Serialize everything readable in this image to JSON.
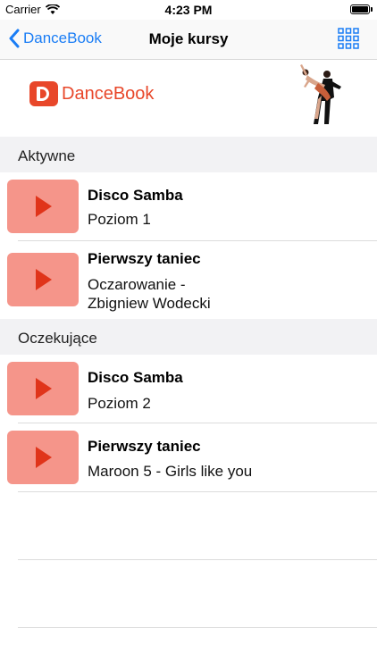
{
  "status_bar": {
    "carrier": "Carrier",
    "time": "4:23 PM",
    "battery_level": 1.0
  },
  "nav": {
    "back_label": "DanceBook",
    "title": "Moje kursy",
    "grid_icon": "grid-icon"
  },
  "header": {
    "logo_text_light": "Dance",
    "logo_text_bold": "Book"
  },
  "sections": [
    {
      "title": "Aktywne",
      "items": [
        {
          "title": "Disco Samba",
          "subtitle": "Poziom 1"
        },
        {
          "title": "Pierwszy taniec",
          "subtitle": "Oczarowanie -",
          "subtitle2": "Zbigniew Wodecki"
        }
      ]
    },
    {
      "title": "Oczekujące",
      "items": [
        {
          "title": "Disco Samba",
          "subtitle": "Poziom 2"
        },
        {
          "title": "Pierwszy taniec",
          "subtitle": "Maroon 5 - Girls like you"
        }
      ]
    }
  ],
  "colors": {
    "accent": "#1a7df5",
    "brand": "#e8472a",
    "thumb": "#f5958a",
    "play": "#e0341a"
  }
}
